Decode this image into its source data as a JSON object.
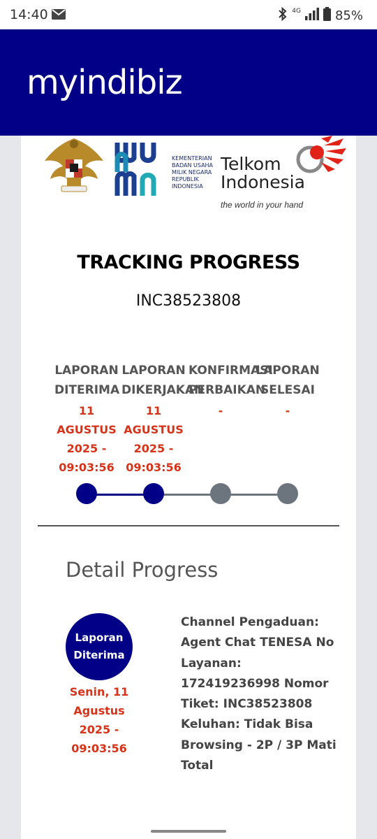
{
  "status_bar": {
    "time": "14:40",
    "network": "4G",
    "battery": "85%"
  },
  "header": {
    "brand": "myindibiz"
  },
  "logos": {
    "bumn_text": [
      "KEMENTERIAN",
      "BADAN USAHA",
      "MILIK NEGARA",
      "REPUBLIK",
      "INDONESIA"
    ],
    "telkom_name_1": "Telkom",
    "telkom_name_2": "Indonesia",
    "telkom_tagline": "the world in your hand"
  },
  "tracking": {
    "title": "TRACKING PROGRESS",
    "ticket": "INC38523808",
    "steps": [
      {
        "label": "LAPORAN DITERIMA",
        "date": "11 AGUSTUS 2025 - 09:03:56",
        "done": true
      },
      {
        "label": "LAPORAN DIKERJAKAN",
        "date": "11 AGUSTUS 2025 - 09:03:56",
        "done": true
      },
      {
        "label": "KONFIRMASI PERBAIKAN",
        "date": "-",
        "done": false
      },
      {
        "label": "LAPORAN SELESAI",
        "date": "-",
        "done": false
      }
    ]
  },
  "detail": {
    "title": "Detail Progress",
    "badge_label": "Laporan Diterima",
    "badge_date": "Senin, 11 Agustus 2025 - 09:03:56",
    "info_text": "Channel Pengaduan: Agent Chat TENESA No Layanan: 172419236998 Nomor Tiket: INC38523808 Keluhan: Tidak Bisa Browsing - 2P / 3P Mati Total"
  },
  "colors": {
    "brand_navy": "#020087",
    "date_red": "#d6341a",
    "inactive_gray": "#6c747e"
  }
}
